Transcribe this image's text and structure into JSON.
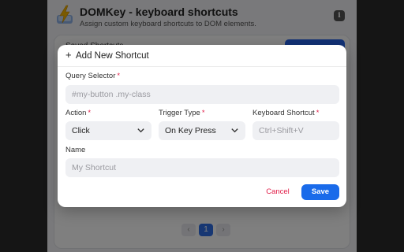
{
  "app": {
    "title": "DOMKey - keyboard shortcuts",
    "subtitle": "Assign custom keyboard shortcuts to DOM elements.",
    "info_icon": "info-icon",
    "logo_icon": "lightning-keycap-icon"
  },
  "background": {
    "card_label": "Saved Shortcuts",
    "pagination": {
      "prev": "‹",
      "current": "1",
      "next": "›"
    }
  },
  "modal": {
    "title": "Add New Shortcut",
    "fields": {
      "query_selector": {
        "label": "Query Selector",
        "required": "*",
        "placeholder": "#my-button .my-class"
      },
      "action": {
        "label": "Action",
        "required": "*",
        "value": "Click"
      },
      "trigger_type": {
        "label": "Trigger Type",
        "required": "*",
        "value": "On Key Press"
      },
      "keyboard_shortcut": {
        "label": "Keyboard Shortcut",
        "required": "*",
        "placeholder": "Ctrl+Shift+V"
      },
      "name": {
        "label": "Name",
        "placeholder": "My Shortcut"
      }
    },
    "buttons": {
      "cancel": "Cancel",
      "save": "Save"
    }
  },
  "colors": {
    "primary": "#1a6bea",
    "danger": "#e11d48",
    "field_bg": "#eff0f3",
    "overlay": "rgba(0,0,0,0.5)"
  }
}
